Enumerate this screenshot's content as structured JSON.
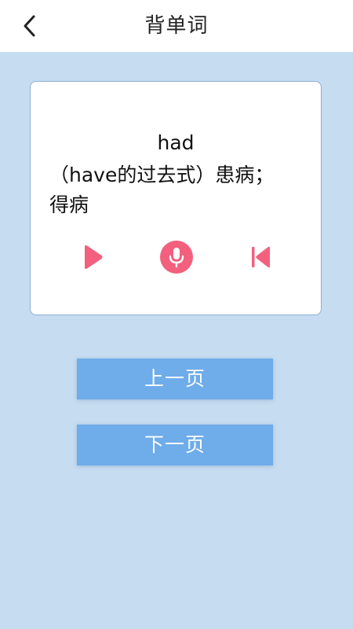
{
  "header": {
    "title": "背单词",
    "back_icon": "chevron-left-icon"
  },
  "card": {
    "word": "had",
    "meaning": "（have的过去式）患病；得病",
    "controls": {
      "play_icon": "play-icon",
      "mic_icon": "microphone-icon",
      "skip_icon": "skip-previous-icon",
      "accent_color": "#f2607e"
    }
  },
  "buttons": {
    "prev_page": "上一页",
    "next_page": "下一页",
    "color": "#6eacea"
  },
  "colors": {
    "background": "#c6dcf1",
    "header_bg": "#ffffff"
  }
}
